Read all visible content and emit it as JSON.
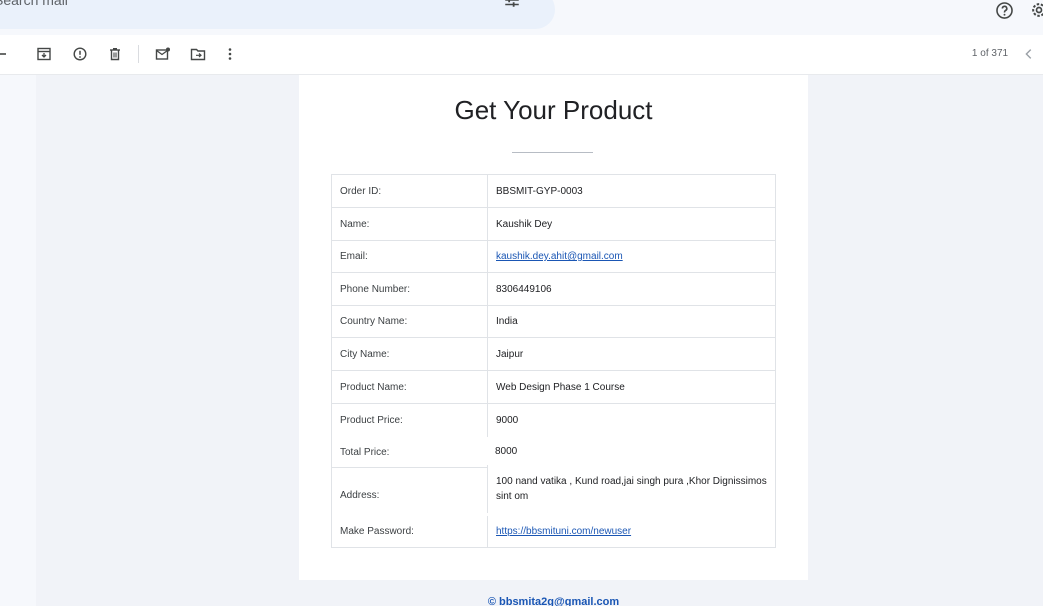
{
  "search": {
    "placeholder": "Search mail"
  },
  "pager": {
    "text": "1 of 371"
  },
  "email": {
    "title": "Get Your Product",
    "rows": [
      {
        "label": "Order ID:",
        "value": "BBSMIT-GYP-0003"
      },
      {
        "label": "Name:",
        "value": "Kaushik Dey"
      },
      {
        "label": "Email:",
        "value": "kaushik.dey.ahit@gmail.com"
      },
      {
        "label": "Phone Number:",
        "value": "8306449106"
      },
      {
        "label": "Country Name:",
        "value": "India"
      },
      {
        "label": "City Name:",
        "value": "Jaipur"
      },
      {
        "label": "Product Name:",
        "value": "Web Design Phase 1 Course"
      },
      {
        "label": "Product Price:",
        "value": "9000"
      },
      {
        "label": "Total Price:",
        "value": "8000"
      },
      {
        "label": "Address:",
        "value": "100 nand vatika , Kund road,jai singh pura ,Khor Dignissimos sint om"
      },
      {
        "label": "Make Password:",
        "value": "https://bbsmituni.com/newuser"
      }
    ],
    "footer": "© bbsmita2g@gmail.com"
  },
  "colors": {
    "link": "#1a56b4",
    "search_bg": "#eaf1fb",
    "page_bg": "#f1f3f8"
  }
}
